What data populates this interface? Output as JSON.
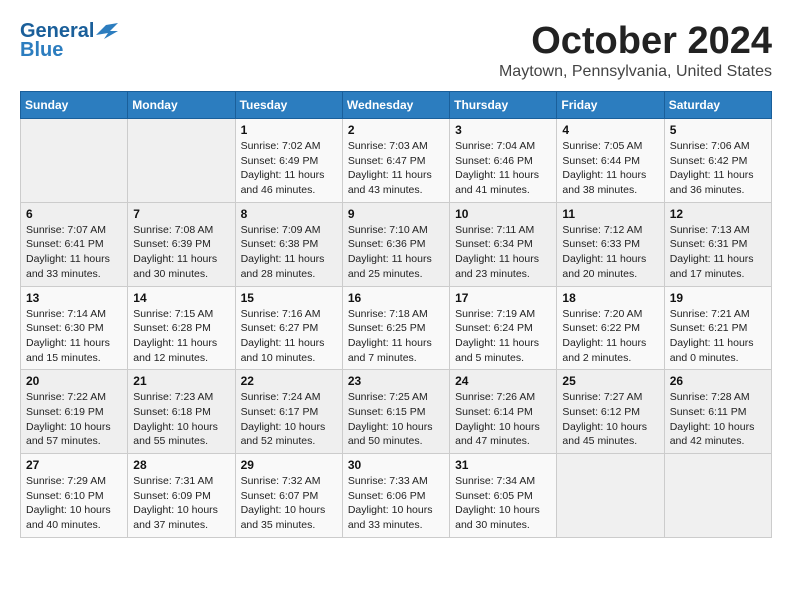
{
  "header": {
    "logo_line1": "General",
    "logo_line2": "Blue",
    "month": "October 2024",
    "location": "Maytown, Pennsylvania, United States"
  },
  "weekdays": [
    "Sunday",
    "Monday",
    "Tuesday",
    "Wednesday",
    "Thursday",
    "Friday",
    "Saturday"
  ],
  "weeks": [
    [
      {
        "day": "",
        "info": ""
      },
      {
        "day": "",
        "info": ""
      },
      {
        "day": "1",
        "info": "Sunrise: 7:02 AM\nSunset: 6:49 PM\nDaylight: 11 hours and 46 minutes."
      },
      {
        "day": "2",
        "info": "Sunrise: 7:03 AM\nSunset: 6:47 PM\nDaylight: 11 hours and 43 minutes."
      },
      {
        "day": "3",
        "info": "Sunrise: 7:04 AM\nSunset: 6:46 PM\nDaylight: 11 hours and 41 minutes."
      },
      {
        "day": "4",
        "info": "Sunrise: 7:05 AM\nSunset: 6:44 PM\nDaylight: 11 hours and 38 minutes."
      },
      {
        "day": "5",
        "info": "Sunrise: 7:06 AM\nSunset: 6:42 PM\nDaylight: 11 hours and 36 minutes."
      }
    ],
    [
      {
        "day": "6",
        "info": "Sunrise: 7:07 AM\nSunset: 6:41 PM\nDaylight: 11 hours and 33 minutes."
      },
      {
        "day": "7",
        "info": "Sunrise: 7:08 AM\nSunset: 6:39 PM\nDaylight: 11 hours and 30 minutes."
      },
      {
        "day": "8",
        "info": "Sunrise: 7:09 AM\nSunset: 6:38 PM\nDaylight: 11 hours and 28 minutes."
      },
      {
        "day": "9",
        "info": "Sunrise: 7:10 AM\nSunset: 6:36 PM\nDaylight: 11 hours and 25 minutes."
      },
      {
        "day": "10",
        "info": "Sunrise: 7:11 AM\nSunset: 6:34 PM\nDaylight: 11 hours and 23 minutes."
      },
      {
        "day": "11",
        "info": "Sunrise: 7:12 AM\nSunset: 6:33 PM\nDaylight: 11 hours and 20 minutes."
      },
      {
        "day": "12",
        "info": "Sunrise: 7:13 AM\nSunset: 6:31 PM\nDaylight: 11 hours and 17 minutes."
      }
    ],
    [
      {
        "day": "13",
        "info": "Sunrise: 7:14 AM\nSunset: 6:30 PM\nDaylight: 11 hours and 15 minutes."
      },
      {
        "day": "14",
        "info": "Sunrise: 7:15 AM\nSunset: 6:28 PM\nDaylight: 11 hours and 12 minutes."
      },
      {
        "day": "15",
        "info": "Sunrise: 7:16 AM\nSunset: 6:27 PM\nDaylight: 11 hours and 10 minutes."
      },
      {
        "day": "16",
        "info": "Sunrise: 7:18 AM\nSunset: 6:25 PM\nDaylight: 11 hours and 7 minutes."
      },
      {
        "day": "17",
        "info": "Sunrise: 7:19 AM\nSunset: 6:24 PM\nDaylight: 11 hours and 5 minutes."
      },
      {
        "day": "18",
        "info": "Sunrise: 7:20 AM\nSunset: 6:22 PM\nDaylight: 11 hours and 2 minutes."
      },
      {
        "day": "19",
        "info": "Sunrise: 7:21 AM\nSunset: 6:21 PM\nDaylight: 11 hours and 0 minutes."
      }
    ],
    [
      {
        "day": "20",
        "info": "Sunrise: 7:22 AM\nSunset: 6:19 PM\nDaylight: 10 hours and 57 minutes."
      },
      {
        "day": "21",
        "info": "Sunrise: 7:23 AM\nSunset: 6:18 PM\nDaylight: 10 hours and 55 minutes."
      },
      {
        "day": "22",
        "info": "Sunrise: 7:24 AM\nSunset: 6:17 PM\nDaylight: 10 hours and 52 minutes."
      },
      {
        "day": "23",
        "info": "Sunrise: 7:25 AM\nSunset: 6:15 PM\nDaylight: 10 hours and 50 minutes."
      },
      {
        "day": "24",
        "info": "Sunrise: 7:26 AM\nSunset: 6:14 PM\nDaylight: 10 hours and 47 minutes."
      },
      {
        "day": "25",
        "info": "Sunrise: 7:27 AM\nSunset: 6:12 PM\nDaylight: 10 hours and 45 minutes."
      },
      {
        "day": "26",
        "info": "Sunrise: 7:28 AM\nSunset: 6:11 PM\nDaylight: 10 hours and 42 minutes."
      }
    ],
    [
      {
        "day": "27",
        "info": "Sunrise: 7:29 AM\nSunset: 6:10 PM\nDaylight: 10 hours and 40 minutes."
      },
      {
        "day": "28",
        "info": "Sunrise: 7:31 AM\nSunset: 6:09 PM\nDaylight: 10 hours and 37 minutes."
      },
      {
        "day": "29",
        "info": "Sunrise: 7:32 AM\nSunset: 6:07 PM\nDaylight: 10 hours and 35 minutes."
      },
      {
        "day": "30",
        "info": "Sunrise: 7:33 AM\nSunset: 6:06 PM\nDaylight: 10 hours and 33 minutes."
      },
      {
        "day": "31",
        "info": "Sunrise: 7:34 AM\nSunset: 6:05 PM\nDaylight: 10 hours and 30 minutes."
      },
      {
        "day": "",
        "info": ""
      },
      {
        "day": "",
        "info": ""
      }
    ]
  ]
}
